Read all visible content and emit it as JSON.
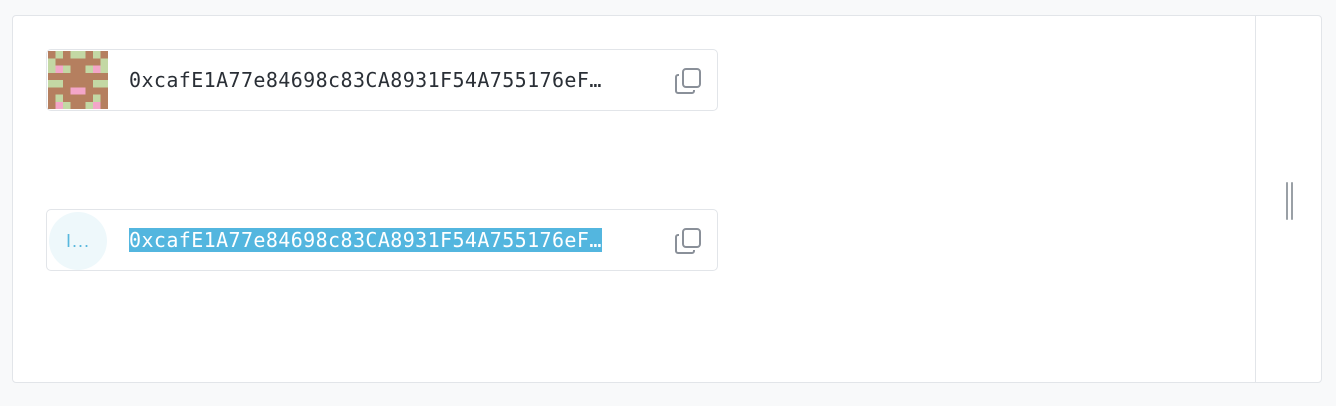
{
  "address_cards": [
    {
      "avatar": {
        "type": "identicon",
        "colors": [
          "#c3d8a4",
          "#b57f5f",
          "#f3a6c8"
        ]
      },
      "address": "0xcafE1A77e84698c83CA8931F54A755176eF…",
      "copy_icon": "copy-icon"
    },
    {
      "avatar": {
        "type": "initials",
        "text": "I..."
      },
      "address": "0xcafE1A77e84698c83CA8931F54A755176eF…",
      "selected": true,
      "copy_icon": "copy-icon"
    }
  ],
  "colors": {
    "selection": "#53b6df",
    "avatar_bg": "#eef8fb",
    "avatar_text": "#58b8de",
    "border": "#e2e5e9"
  },
  "resize_handle_icon": "resize-grip-icon"
}
